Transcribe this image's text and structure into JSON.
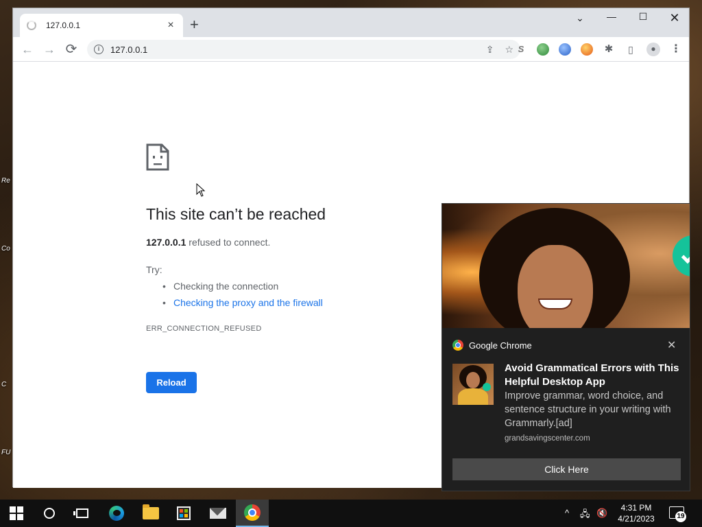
{
  "desktop": {
    "labels": [
      "Re",
      "Co",
      "C",
      "FU"
    ]
  },
  "browser": {
    "tab": {
      "title": "127.0.0.1",
      "close_icon": "×"
    },
    "new_tab_icon": "+",
    "window_controls": {
      "tab_search": "⌄",
      "minimize": "—",
      "maximize": "☐",
      "close": "✕"
    },
    "nav": {
      "back": "←",
      "forward": "→",
      "reload": "⟳"
    },
    "omnibox": {
      "info_icon": "i",
      "url": "127.0.0.1",
      "share_icon": "⇪",
      "bookmark_icon": "☆"
    },
    "extensions": {
      "s_label": "S",
      "puzzle": "✱",
      "side_panel": "▯",
      "profile": "●",
      "menu": "⋮"
    }
  },
  "error_page": {
    "title": "This site can’t be reached",
    "host": "127.0.0.1",
    "detail_suffix": " refused to connect.",
    "try_label": "Try:",
    "suggestions": [
      "Checking the connection",
      "Checking the proxy and the firewall"
    ],
    "error_code": "ERR_CONNECTION_REFUSED",
    "reload_label": "Reload"
  },
  "notification": {
    "app_name": "Google Chrome",
    "close_icon": "✕",
    "title": "Avoid Grammatical Errors with This Helpful Desktop App",
    "body": "Improve grammar, word choice, and sentence structure in your writing with Grammarly.[ad]",
    "source": "grandsavingscenter.com",
    "action_label": "Click Here"
  },
  "taskbar": {
    "tray_chevron": "^",
    "network_icon": "🖧",
    "volume_icon": "🔇",
    "time": "4:31 PM",
    "date": "4/21/2023",
    "notification_count": "19"
  }
}
